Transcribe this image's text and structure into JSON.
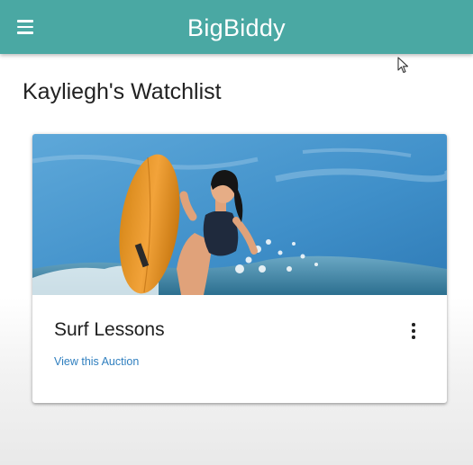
{
  "app": {
    "title": "BigBiddy",
    "brand_color": "#4aa8a3"
  },
  "header": {
    "menu_icon": "hamburger-menu-icon"
  },
  "page": {
    "title": "Kayliegh's Watchlist"
  },
  "watchlist": {
    "items": [
      {
        "title": "Surf Lessons",
        "link_label": "View this Auction",
        "image": "surfer-photo",
        "menu_icon": "more-vert-icon"
      }
    ]
  },
  "colors": {
    "link": "#2f7fbf",
    "text": "#222222"
  }
}
